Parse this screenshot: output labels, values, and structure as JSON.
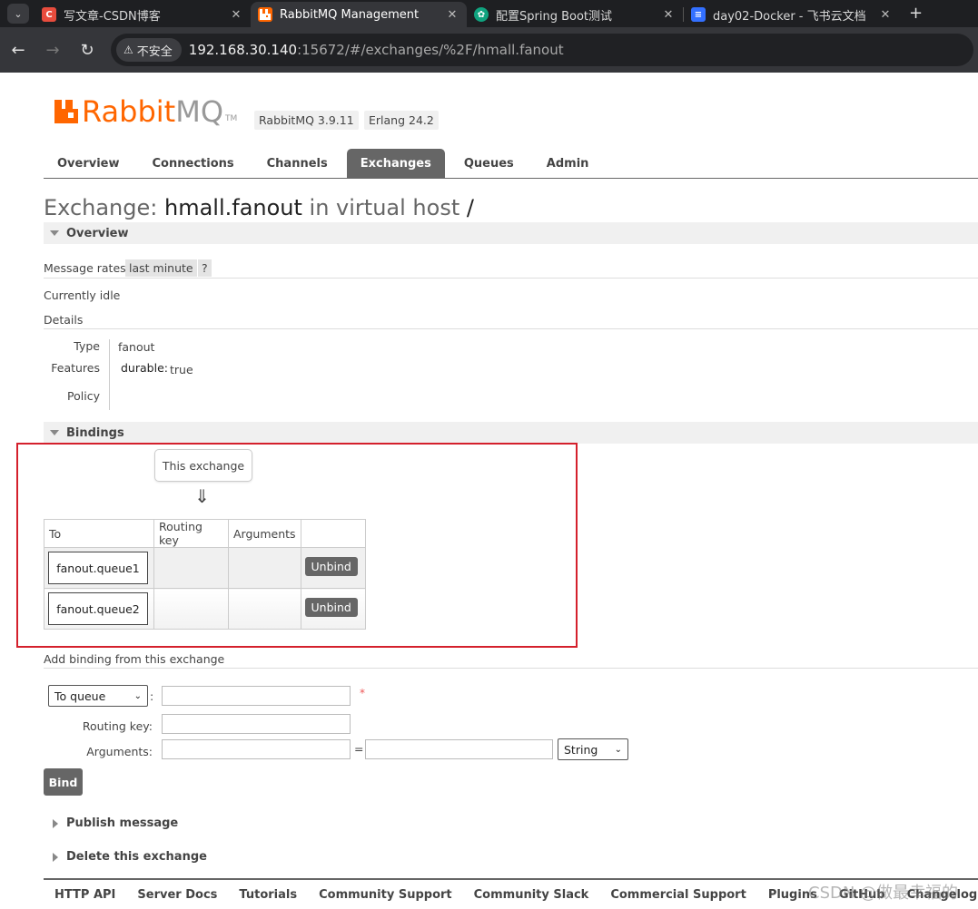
{
  "browser": {
    "tabs": [
      {
        "title": "写文章-CSDN博客",
        "favicon": "csdn-icon",
        "favicon_color": "#e84c3d",
        "favicon_char": "C",
        "active": false
      },
      {
        "title": "RabbitMQ Management",
        "favicon": "rabbitmq-icon",
        "favicon_color": "#ff6600",
        "favicon_char": "",
        "active": true
      },
      {
        "title": "配置Spring Boot测试",
        "favicon": "chatgpt-icon",
        "favicon_color": "#10a37f",
        "favicon_char": "",
        "active": false
      },
      {
        "title": "day02-Docker - 飞书云文档",
        "favicon": "feishu-doc-icon",
        "favicon_color": "#3370ff",
        "favicon_char": "",
        "active": false
      }
    ],
    "security_label": "不安全",
    "url_host": "192.168.30.140",
    "url_rest": ":15672/#/exchanges/%2F/hmall.fanout"
  },
  "header": {
    "logo_rabbit": "Rabbit",
    "logo_mq": "MQ",
    "logo_tm": "TM",
    "version": "RabbitMQ 3.9.11",
    "erlang": "Erlang 24.2"
  },
  "nav": {
    "tabs": [
      "Overview",
      "Connections",
      "Channels",
      "Exchanges",
      "Queues",
      "Admin"
    ],
    "selected": "Exchanges"
  },
  "title": {
    "prefix": "Exchange: ",
    "name": "hmall.fanout",
    "middle": " in virtual host ",
    "vhost": "/"
  },
  "overview": {
    "heading": "Overview",
    "message_rates_label": "Message rates",
    "message_rates_period": "last minute",
    "help": "?",
    "status": "Currently idle",
    "details_label": "Details",
    "type_label": "Type",
    "type_value": "fanout",
    "features_label": "Features",
    "features_key": "durable:",
    "features_value": "true",
    "policy_label": "Policy"
  },
  "bindings": {
    "heading": "Bindings",
    "source_label": "This exchange",
    "arrow": "⇓",
    "columns": [
      "To",
      "Routing key",
      "Arguments",
      ""
    ],
    "rows": [
      {
        "to": "fanout.queue1",
        "routing_key": "",
        "arguments": "",
        "action": "Unbind"
      },
      {
        "to": "fanout.queue2",
        "routing_key": "",
        "arguments": "",
        "action": "Unbind"
      }
    ]
  },
  "add_binding": {
    "heading": "Add binding from this exchange",
    "destination_type": "To queue",
    "destination_value": "",
    "required_mark": "*",
    "routing_key_label": "Routing key:",
    "routing_key_value": "",
    "arguments_label": "Arguments:",
    "arg_key": "",
    "equals": "=",
    "arg_value": "",
    "arg_type": "String",
    "bind_button": "Bind"
  },
  "collapsed_sections": [
    "Publish message",
    "Delete this exchange"
  ],
  "footer": {
    "links": [
      "HTTP API",
      "Server Docs",
      "Tutorials",
      "Community Support",
      "Community Slack",
      "Commercial Support",
      "Plugins",
      "GitHub",
      "Changelog"
    ]
  },
  "watermark": "CSDN @做最幸福的"
}
